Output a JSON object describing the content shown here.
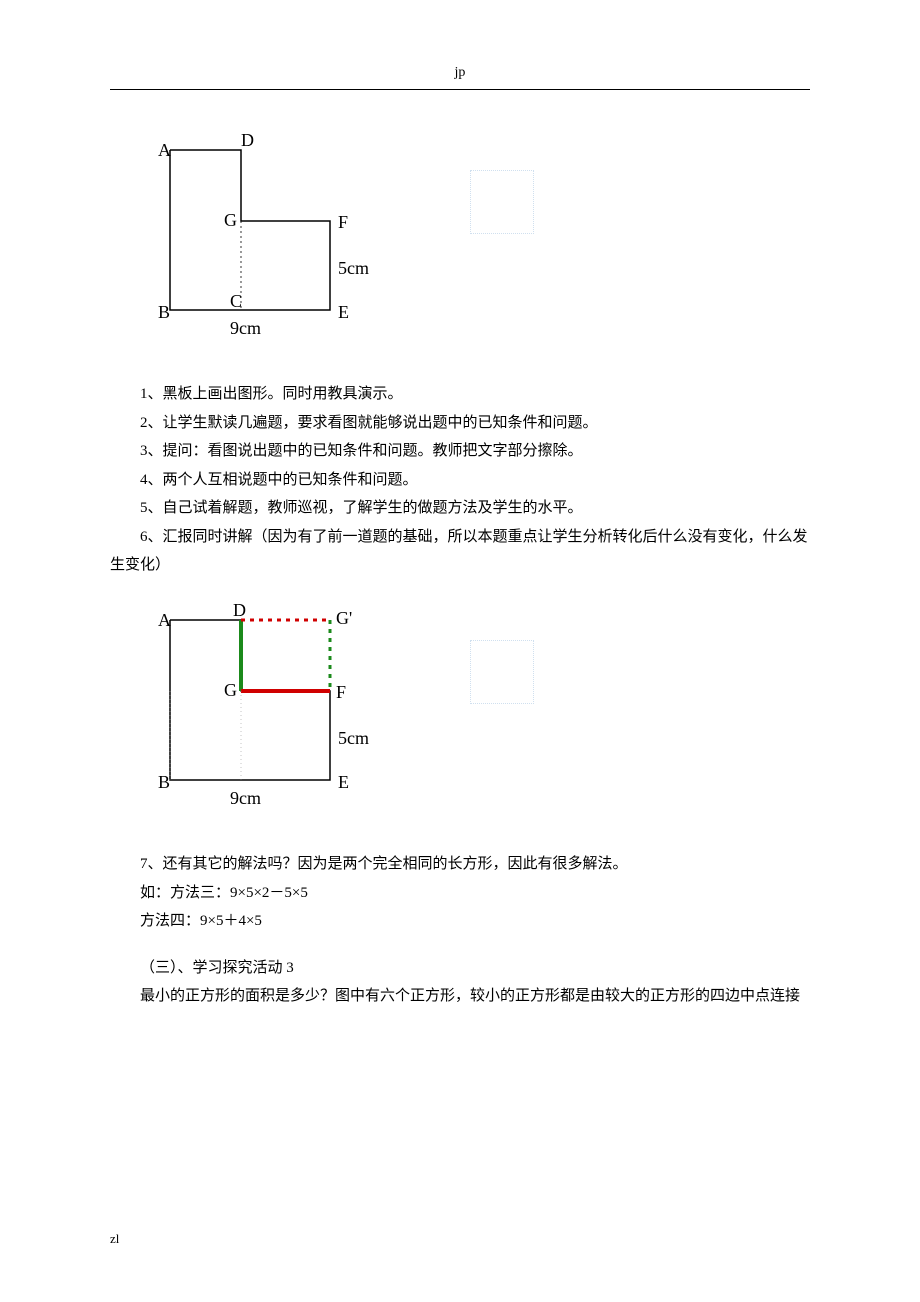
{
  "header": {
    "title": "jp"
  },
  "footer": {
    "label": "zl"
  },
  "diagram1": {
    "labels": {
      "A": "A",
      "D": "D",
      "G": "G",
      "F": "F",
      "B": "B",
      "C": "C",
      "E": "E"
    },
    "right_label": "5cm",
    "bottom_label": "9cm",
    "widthPx": 160,
    "heightPx": 160,
    "stepXPx": 71,
    "stepYPx": 71
  },
  "diagram2": {
    "labels": {
      "A": "A",
      "D": "D",
      "Gp": "G'",
      "G": "G",
      "F": "F",
      "B": "B",
      "E": "E"
    },
    "right_label": "5cm",
    "bottom_label": "9cm",
    "widthPx": 160,
    "heightPx": 160,
    "stepXPx": 71,
    "stepYPx": 71
  },
  "paragraphs": {
    "p1": "1、黑板上画出图形。同时用教具演示。",
    "p2": "2、让学生默读几遍题，要求看图就能够说出题中的已知条件和问题。",
    "p3": "3、提问：看图说出题中的已知条件和问题。教师把文字部分擦除。",
    "p4": "4、两个人互相说题中的已知条件和问题。",
    "p5": "5、自己试着解题，教师巡视，了解学生的做题方法及学生的水平。",
    "p6a": "6、汇报同时讲解（因为有了前一道题的基础，所以本题重点让学生分析转化后什么没有变化，什么发",
    "p6b": "生变化）",
    "p7": "7、还有其它的解法吗？因为是两个完全相同的长方形，因此有很多解法。",
    "p8": "如：方法三：9×5×2－5×5",
    "p9": "方法四：9×5＋4×5",
    "p10": "（三）、学习探究活动 3",
    "p11": "最小的正方形的面积是多少？图中有六个正方形，较小的正方形都是由较大的正方形的四边中点连接"
  }
}
